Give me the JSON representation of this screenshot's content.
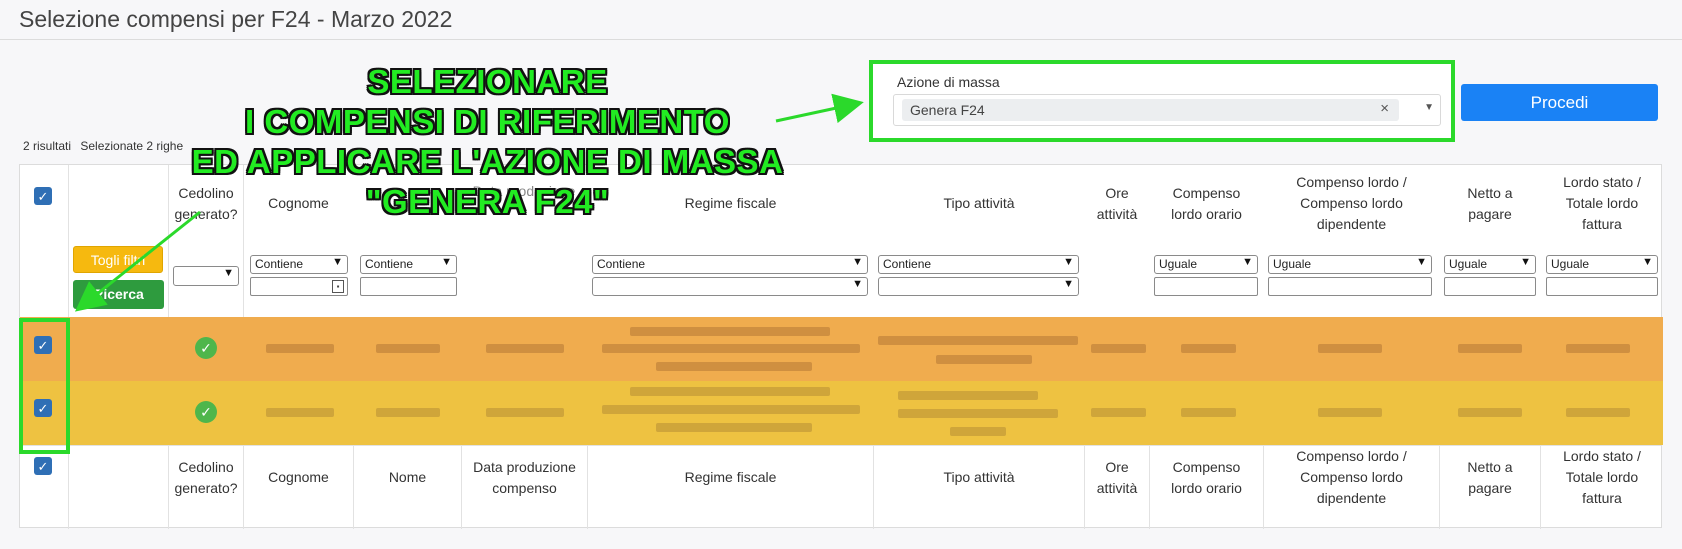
{
  "page": {
    "title": "Selezione compensi per F24 - Marzo 2022"
  },
  "mass_action": {
    "label": "Azione di massa",
    "selected": "Genera F24",
    "clear_glyph": "×"
  },
  "procedi_label": "Procedi",
  "results": {
    "count": "2 risultati",
    "selected": "Selezionate 2 righe"
  },
  "filters": {
    "toggle_label": "Togli filtri",
    "search_label": "Ricerca"
  },
  "columns": {
    "cedolino": [
      "Cedolino",
      "generato?"
    ],
    "cognome": "Cognome",
    "nome": "Nome",
    "data": [
      "Data produzione",
      "compenso"
    ],
    "regime": "Regime fiscale",
    "tipo": "Tipo attività",
    "ore": [
      "Ore",
      "attività"
    ],
    "orario": [
      "Compenso",
      "lordo orario"
    ],
    "dipendente": [
      "Compenso lordo /",
      "Compenso lordo",
      "dipendente"
    ],
    "netto": [
      "Netto a",
      "pagare"
    ],
    "lordo": [
      "Lordo stato /",
      "Totale lordo",
      "fattura"
    ]
  },
  "filter_options": {
    "contiene": "Contiene",
    "uguale": "Uguale"
  },
  "annotation": {
    "lines": [
      "SELEZIONARE",
      "I COMPENSI DI RIFERIMENTO",
      "ED APPLICARE L'AZIONE DI MASSA",
      "\"GENERA F24\""
    ]
  },
  "colors": {
    "accent": "#1a82f5",
    "row1": "#f0ac4e",
    "row2": "#eec241",
    "highlight": "#2bd92b",
    "filter_btn": "#f6b90f",
    "search_btn": "#2e9b3e"
  },
  "icons": {
    "check": "check-icon",
    "ok": "check-circle-icon",
    "caret": "chevron-down-icon",
    "calendar": "calendar-icon"
  }
}
